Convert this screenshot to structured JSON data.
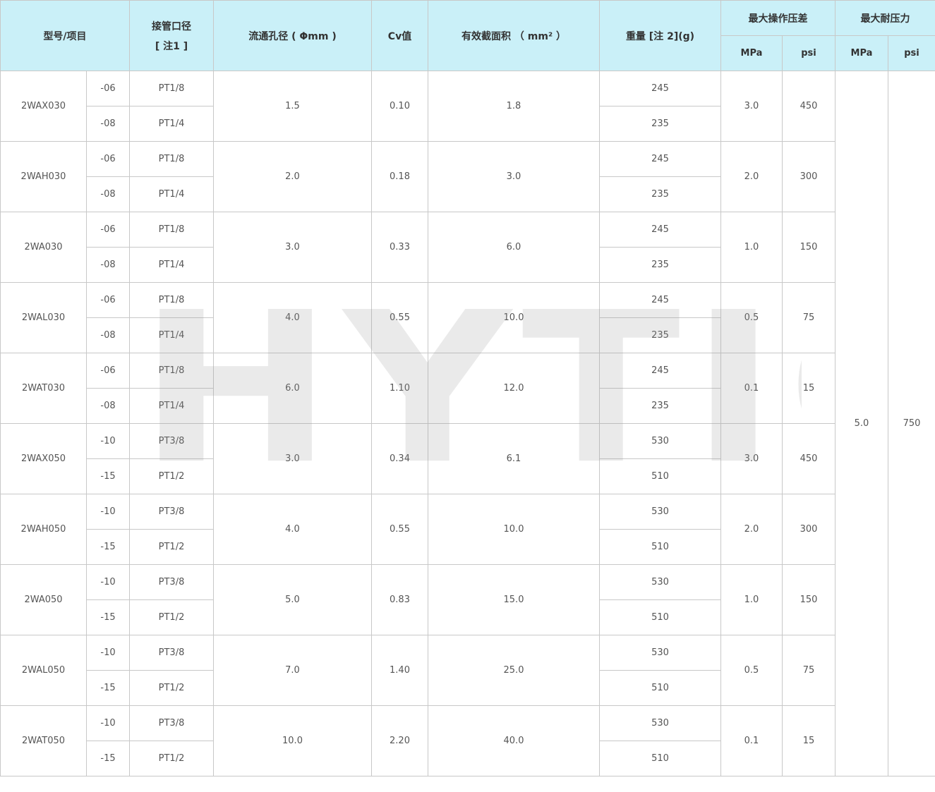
{
  "headers": {
    "model": "型号/项目",
    "port": "接管口径",
    "port_note": "[ 注1 ]",
    "orifice": "流通孔径 ( Φmm )",
    "cv": "Cv值",
    "area": "有效截面积 （ mm² ）",
    "weight": "重量 [注 2](g)",
    "max_op": "最大操作压差",
    "max_proof": "最大耐压力",
    "mpa": "MPa",
    "psi": "psi"
  },
  "proof_pressure": {
    "mpa": "5.0",
    "psi": "750"
  },
  "rows": [
    {
      "model": "2WAX030",
      "orifice": "1.5",
      "cv": "0.10",
      "area": "1.8",
      "mpa": "3.0",
      "psi": "450",
      "variants": [
        {
          "code": "-06",
          "port": "PT1/8",
          "weight": "245"
        },
        {
          "code": "-08",
          "port": "PT1/4",
          "weight": "235"
        }
      ]
    },
    {
      "model": "2WAH030",
      "orifice": "2.0",
      "cv": "0.18",
      "area": "3.0",
      "mpa": "2.0",
      "psi": "300",
      "variants": [
        {
          "code": "-06",
          "port": "PT1/8",
          "weight": "245"
        },
        {
          "code": "-08",
          "port": "PT1/4",
          "weight": "235"
        }
      ]
    },
    {
      "model": "2WA030",
      "orifice": "3.0",
      "cv": "0.33",
      "area": "6.0",
      "mpa": "1.0",
      "psi": "150",
      "variants": [
        {
          "code": "-06",
          "port": "PT1/8",
          "weight": "245"
        },
        {
          "code": "-08",
          "port": "PT1/4",
          "weight": "235"
        }
      ]
    },
    {
      "model": "2WAL030",
      "orifice": "4.0",
      "cv": "0.55",
      "area": "10.0",
      "mpa": "0.5",
      "psi": "75",
      "variants": [
        {
          "code": "-06",
          "port": "PT1/8",
          "weight": "245"
        },
        {
          "code": "-08",
          "port": "PT1/4",
          "weight": "235"
        }
      ]
    },
    {
      "model": "2WAT030",
      "orifice": "6.0",
      "cv": "1.10",
      "area": "12.0",
      "mpa": "0.1",
      "psi": "15",
      "variants": [
        {
          "code": "-06",
          "port": "PT1/8",
          "weight": "245"
        },
        {
          "code": "-08",
          "port": "PT1/4",
          "weight": "235"
        }
      ]
    },
    {
      "model": "2WAX050",
      "orifice": "3.0",
      "cv": "0.34",
      "area": "6.1",
      "mpa": "3.0",
      "psi": "450",
      "variants": [
        {
          "code": "-10",
          "port": "PT3/8",
          "weight": "530"
        },
        {
          "code": "-15",
          "port": "PT1/2",
          "weight": "510"
        }
      ]
    },
    {
      "model": "2WAH050",
      "orifice": "4.0",
      "cv": "0.55",
      "area": "10.0",
      "mpa": "2.0",
      "psi": "300",
      "variants": [
        {
          "code": "-10",
          "port": "PT3/8",
          "weight": "530"
        },
        {
          "code": "-15",
          "port": "PT1/2",
          "weight": "510"
        }
      ]
    },
    {
      "model": "2WA050",
      "orifice": "5.0",
      "cv": "0.83",
      "area": "15.0",
      "mpa": "1.0",
      "psi": "150",
      "variants": [
        {
          "code": "-10",
          "port": "PT3/8",
          "weight": "530"
        },
        {
          "code": "-15",
          "port": "PT1/2",
          "weight": "510"
        }
      ]
    },
    {
      "model": "2WAL050",
      "orifice": "7.0",
      "cv": "1.40",
      "area": "25.0",
      "mpa": "0.5",
      "psi": "75",
      "variants": [
        {
          "code": "-10",
          "port": "PT3/8",
          "weight": "530"
        },
        {
          "code": "-15",
          "port": "PT1/2",
          "weight": "510"
        }
      ]
    },
    {
      "model": "2WAT050",
      "orifice": "10.0",
      "cv": "2.20",
      "area": "40.0",
      "mpa": "0.1",
      "psi": "15",
      "variants": [
        {
          "code": "-10",
          "port": "PT3/8",
          "weight": "530"
        },
        {
          "code": "-15",
          "port": "PT1/2",
          "weight": "510"
        }
      ]
    }
  ],
  "watermark": "HYTIC"
}
